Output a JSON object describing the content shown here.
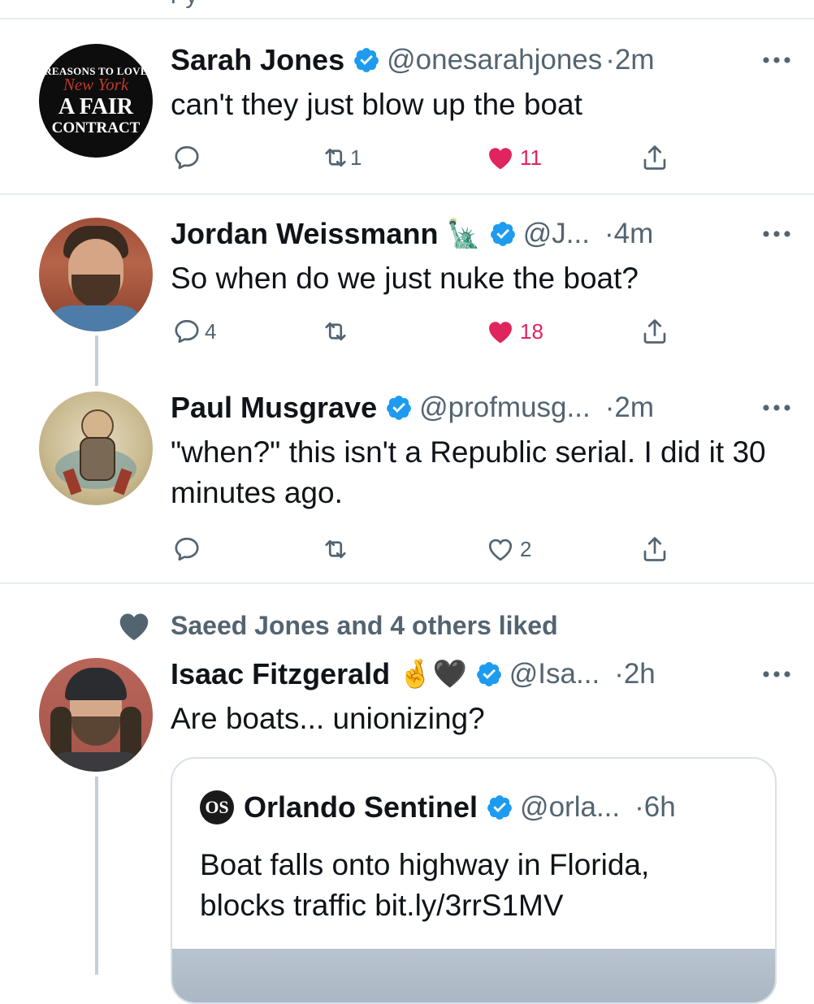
{
  "top_cut_text": "r y",
  "tweets": [
    {
      "name": "Sarah Jones",
      "handle": "@onesarahjones",
      "time": "2m",
      "text": "can't they just blow up the boat",
      "reply_count": "",
      "retweet_count": "1",
      "like_count": "11",
      "liked": true,
      "avatar_text": {
        "line1": "REASONS TO LOVE",
        "line2": "New York",
        "line3": "A FAIR",
        "line4": "CONTRACT"
      }
    },
    {
      "name": "Jordan Weissmann",
      "emoji": "🗽",
      "handle": "@J...",
      "time": "4m",
      "text": "So when do we just nuke the boat?",
      "reply_count": "4",
      "retweet_count": "",
      "like_count": "18",
      "liked": true
    },
    {
      "name": "Paul Musgrave",
      "handle": "@profmusg...",
      "time": "2m",
      "text": "\"when?\" this isn't a Republic serial. I did it 30 minutes ago.",
      "reply_count": "",
      "retweet_count": "",
      "like_count": "2",
      "liked": false
    },
    {
      "social_context": "Saeed Jones and 4 others liked",
      "name": "Isaac Fitzgerald",
      "emoji": "🤞🖤",
      "handle": "@Isa...",
      "time": "2h",
      "text": "Are boats... unionizing?",
      "quote": {
        "logo_text": "OS",
        "name": "Orlando Sentinel",
        "handle": "@orla...",
        "time": "6h",
        "text": "Boat falls onto highway in Florida, blocks traffic bit.ly/3rrS1MV"
      }
    }
  ],
  "separator": "·",
  "more_glyph": "···",
  "colors": {
    "verified": "#1d9bf0",
    "like": "#e0245e",
    "secondary": "#536471",
    "divider": "#e6ecf0"
  }
}
